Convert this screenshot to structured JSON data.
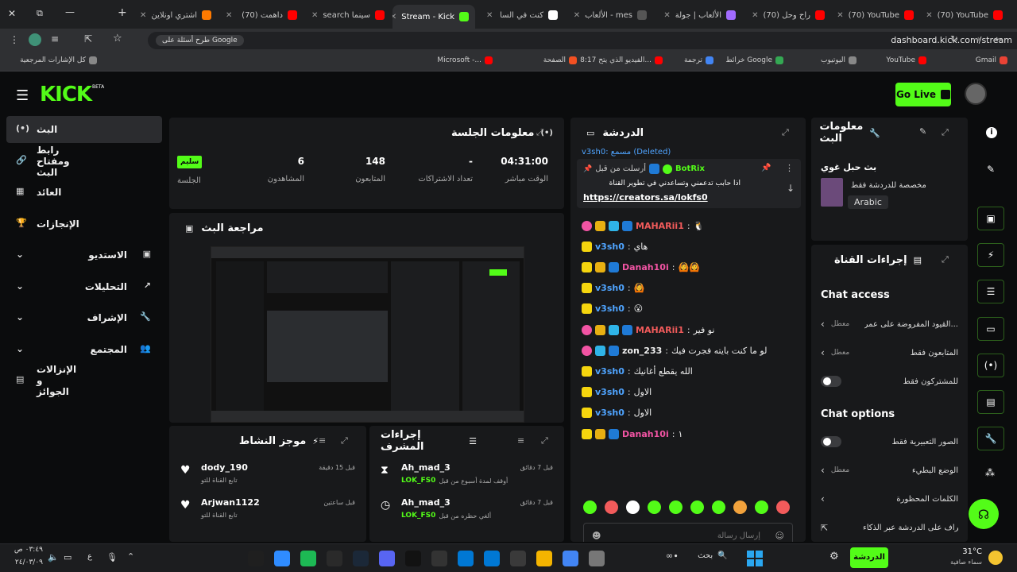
{
  "browser": {
    "tabs": [
      {
        "label": "(70) YouTube",
        "fav": "#ff0000"
      },
      {
        "label": "(70) YouTube",
        "fav": "#ff0000"
      },
      {
        "label": "(70) راح وحل",
        "fav": "#ff0000"
      },
      {
        "label": "الألعاب | جولة",
        "fav": "#a26bff"
      },
      {
        "label": "الألعاب - mes",
        "fav": "#555555"
      },
      {
        "label": "كنت في السا",
        "fav": "#ffffff"
      },
      {
        "label": "Stream - Kick",
        "fav": "#53fc18",
        "active": true
      },
      {
        "label": "search سينما",
        "fav": "#ff0000"
      },
      {
        "label": "(70) داهمت",
        "fav": "#ff0000"
      },
      {
        "label": "اشتري اونلاين",
        "fav": "#ff7a00"
      }
    ],
    "url": "dashboard.kick.com/stream",
    "google_chip": "طرح أسئلة على Google",
    "bookmarks": [
      {
        "label": "Gmail",
        "fav": "#ea4335"
      },
      {
        "label": "YouTube",
        "fav": "#ff0000"
      },
      {
        "label": "اليوتيوب",
        "fav": "#888888"
      },
      {
        "label": "خرائط Google",
        "fav": "#34a853"
      },
      {
        "label": "ترجمة",
        "fav": "#4285f4"
      },
      {
        "label": "8:17 الفيديو الذي يتح...",
        "fav": "#ff0000"
      },
      {
        "label": "الصفحة",
        "fav": "#f25022"
      },
      {
        "label": "Microsoft -...",
        "fav": "#ff0000"
      },
      {
        "label": "كل الإشارات المرجعية",
        "fav": "#888888"
      }
    ]
  },
  "header": {
    "logo": "KICK",
    "logo_beta": "BETA",
    "go_live": "Go Live",
    "accent": "#53fc18"
  },
  "sidebar": {
    "items": [
      {
        "label": "البث",
        "icon": "broadcast-icon",
        "glyph": "(•)",
        "active": true
      },
      {
        "label": "رابط ومفتاح البث",
        "icon": "link-icon",
        "glyph": "🔗"
      },
      {
        "label": "العائد",
        "icon": "bank-icon",
        "glyph": "▦"
      },
      {
        "label": "الإنجازات",
        "icon": "trophy-icon",
        "glyph": "🏆"
      },
      {
        "label": "الاستديو",
        "icon": "studio-icon",
        "glyph": "▣",
        "chevron": true
      },
      {
        "label": "التحليلات",
        "icon": "analytics-icon",
        "glyph": "↗",
        "chevron": true
      },
      {
        "label": "الإشراف",
        "icon": "wrench-icon",
        "glyph": "🔧",
        "chevron": true
      },
      {
        "label": "المجتمع",
        "icon": "community-icon",
        "glyph": "👥",
        "chevron": true
      },
      {
        "label": "الإنزالات و الجوائز",
        "icon": "drops-icon",
        "glyph": "▤"
      }
    ]
  },
  "session": {
    "title": "معلومات الجلسة",
    "stats": [
      {
        "value": "04:31:00",
        "label": "الوقت مباشر"
      },
      {
        "value": "-",
        "label": "تعداد الاشتراكات"
      },
      {
        "value": "148",
        "label": "المتابعون"
      },
      {
        "value": "6",
        "label": "المشاهدون"
      },
      {
        "value": "سليم",
        "label": "الجلسة"
      }
    ]
  },
  "preview": {
    "title": "مراجعة البث"
  },
  "activity": {
    "title": "موجز النشاط",
    "items": [
      {
        "user": "dody_190",
        "sub": "تابع القناة للتو",
        "time": "قبل 15 دقيقة"
      },
      {
        "user": "Arjwan1122",
        "sub": "تابع القناة للتو",
        "time": "قبل ساعتين"
      }
    ]
  },
  "modactions": {
    "title": "إجراءات المشرف",
    "items": [
      {
        "user": "Ah_mad_3",
        "sub": "أوقف لمدة أسبوع من قبل",
        "by": "LOK_FS0",
        "time": "قبل 7 دقائق"
      },
      {
        "user": "Ah_mad_3",
        "sub": "ألغي حظره من قبل",
        "by": "LOK_FS0",
        "time": "قبل 7 دقائق"
      }
    ]
  },
  "chat": {
    "title": "الدردشة",
    "top_line": "v3sh0: مسمع (Deleted)",
    "pinned": {
      "sent_by": "أرسلت من قبل",
      "bot": "BotRix",
      "text": "اذا حابب تدعمني وتساعدني في تطوير القناة",
      "link": "https://creators.sa/lokfs0"
    },
    "messages": [
      {
        "user": "MAHARii1",
        "color": "#f25b5b",
        "badges": [
          "pink",
          "crown",
          "og",
          "ver"
        ],
        "text": "🐧"
      },
      {
        "user": "v3sh0",
        "color": "#4fa4ff",
        "badges": [
          "sub"
        ],
        "text": "هاي"
      },
      {
        "user": "Danah10i",
        "color": "#f254a4",
        "badges": [
          "sub",
          "crown",
          "ver"
        ],
        "text": "🙆🙆"
      },
      {
        "user": "v3sh0",
        "color": "#4fa4ff",
        "badges": [
          "sub"
        ],
        "text": "🙆"
      },
      {
        "user": "v3sh0",
        "color": "#4fa4ff",
        "badges": [
          "sub"
        ],
        "text": "😮"
      },
      {
        "user": "MAHARii1",
        "color": "#f25b5b",
        "badges": [
          "pink",
          "crown",
          "og",
          "ver"
        ],
        "text": "نو فير"
      },
      {
        "user": "zon_233",
        "color": "#f0f0f0",
        "badges": [
          "pink",
          "og",
          "ver"
        ],
        "text": "لو ما كنت بايته فجرت فيك"
      },
      {
        "user": "v3sh0",
        "color": "#4fa4ff",
        "badges": [
          "sub"
        ],
        "text": "الله يقطع أغانيك"
      },
      {
        "user": "v3sh0",
        "color": "#4fa4ff",
        "badges": [
          "sub"
        ],
        "text": "الاول"
      },
      {
        "user": "v3sh0",
        "color": "#4fa4ff",
        "badges": [
          "sub"
        ],
        "text": "الاول"
      },
      {
        "user": "Danah10i",
        "color": "#f254a4",
        "badges": [
          "sub",
          "crown",
          "ver"
        ],
        "text": "١"
      }
    ],
    "input_placeholder": "إرسال رسالة",
    "send_label": "الدردشة"
  },
  "stream_info": {
    "title": "معلومات البث",
    "stream_title": "بث حبل غوي",
    "category": "مخصصة للدردشة فقط",
    "language": "Arabic"
  },
  "channel_actions": {
    "title": "إجراءات القناة",
    "chat_access_title": "Chat access",
    "chat_options_title": "Chat options",
    "access_rows": [
      {
        "label": "القيود المفروضة على عمر...",
        "value": "معطل",
        "type": "chevron"
      },
      {
        "label": "المتابعون فقط",
        "value": "معطل",
        "type": "chevron"
      },
      {
        "label": "للمشتركون فقط",
        "value": "",
        "type": "toggle"
      }
    ],
    "option_rows": [
      {
        "label": "الصور التعبيرية فقط",
        "value": "",
        "type": "toggle"
      },
      {
        "label": "الوضع البطيء",
        "value": "معطل",
        "type": "chevron"
      },
      {
        "label": "الكلمات المحظورة",
        "value": "",
        "type": "chevron"
      },
      {
        "label": "الإشراف على الدردشة عبر الذكاء...",
        "value": "",
        "type": "external"
      }
    ]
  },
  "taskbar": {
    "weather_temp": "31°C",
    "weather_text": "سماء صافية",
    "time": "٠٣:٤٩ ص",
    "date": "٢٤/٠٣/٠٩",
    "search_label": "بحث",
    "chat_btn": "الدردشة"
  }
}
